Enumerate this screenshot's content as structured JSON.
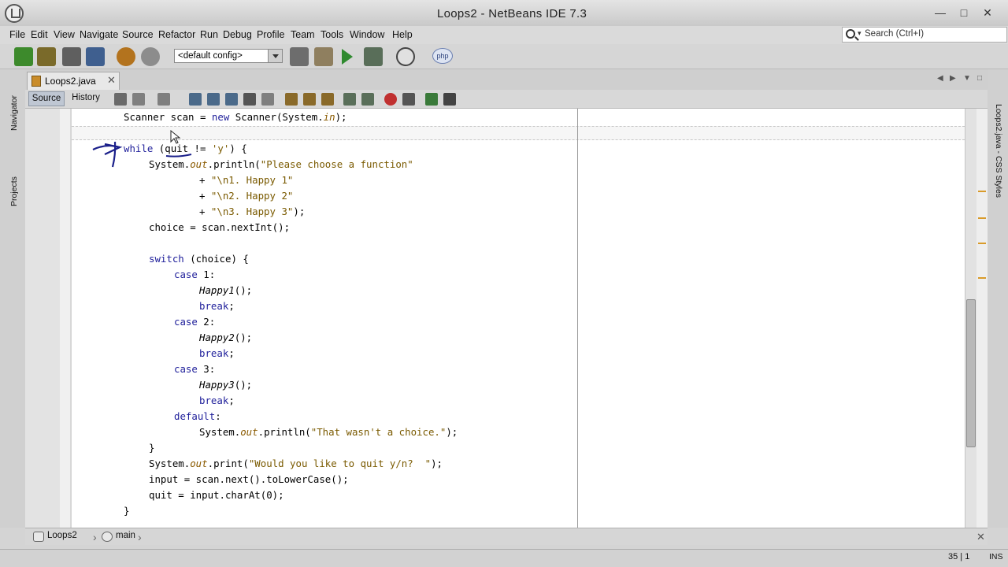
{
  "window": {
    "title": "Loops2 - NetBeans IDE 7.3"
  },
  "menu": [
    "File",
    "Edit",
    "View",
    "Navigate",
    "Source",
    "Refactor",
    "Run",
    "Debug",
    "Profile",
    "Team",
    "Tools",
    "Window",
    "Help"
  ],
  "search": {
    "placeholder": "Search (Ctrl+I)"
  },
  "toolbar": {
    "config": "<default config>",
    "php_label": "php"
  },
  "side": {
    "navigator": "Navigator",
    "projects": "Projects",
    "right_label": "Loops2.java - CSS Styles"
  },
  "editor": {
    "tab": "Loops2.java",
    "source_btn": "Source",
    "history_btn": "History"
  },
  "code": [
    "Scanner scan = new Scanner(System.in);",
    "",
    "while (quit != 'y') {",
    "System.out.println(\"Please choose a function\"",
    "+ \"\\n1. Happy 1\"",
    "+ \"\\n2. Happy 2\"",
    "+ \"\\n3. Happy 3\");",
    "choice = scan.nextInt();",
    "",
    "switch (choice) {",
    "case 1:",
    "Happy1();",
    "break;",
    "case 2:",
    "Happy2();",
    "break;",
    "case 3:",
    "Happy3();",
    "break;",
    "default:",
    "System.out.println(\"That wasn't a choice.\");",
    "}",
    "System.out.print(\"Would you like to quit y/n?  \");",
    "input = scan.next().toLowerCase();",
    "quit = input.charAt(0);",
    "}"
  ],
  "breadcrumbs": [
    "Loops2",
    "main"
  ],
  "status": {
    "position": "35 | 1",
    "mode": "INS"
  }
}
